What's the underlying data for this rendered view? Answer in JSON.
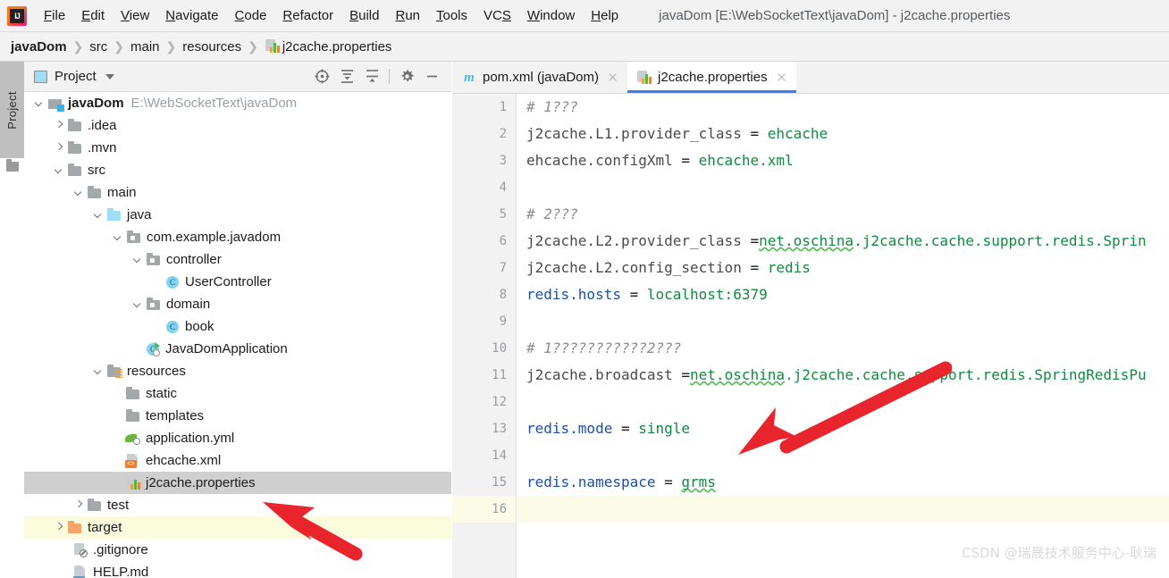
{
  "window": {
    "title": "javaDom [E:\\WebSocketText\\javaDom] - j2cache.properties",
    "app_icon": "intellij-idea-logo"
  },
  "menubar": {
    "items": [
      {
        "label": "File"
      },
      {
        "label": "Edit"
      },
      {
        "label": "View"
      },
      {
        "label": "Navigate"
      },
      {
        "label": "Code"
      },
      {
        "label": "Refactor"
      },
      {
        "label": "Build"
      },
      {
        "label": "Run"
      },
      {
        "label": "Tools"
      },
      {
        "label": "VCS"
      },
      {
        "label": "Window"
      },
      {
        "label": "Help"
      }
    ]
  },
  "breadcrumb": {
    "items": [
      {
        "label": "javaDom",
        "bold": true
      },
      {
        "label": "src"
      },
      {
        "label": "main"
      },
      {
        "label": "resources"
      },
      {
        "label": "j2cache.properties",
        "icon": "properties-file-icon"
      }
    ],
    "separator": "❯"
  },
  "tool_strip": {
    "project_tab_label": "Project",
    "folder_icon": "folder-icon"
  },
  "project_panel": {
    "header": {
      "title": "Project",
      "view_icon": "project-view-icon",
      "dropdown_icon": "chevron-down-icon",
      "tools": [
        {
          "name": "select-opened-file-icon",
          "title": "Select Opened File"
        },
        {
          "name": "expand-all-icon",
          "title": "Expand All"
        },
        {
          "name": "collapse-all-icon",
          "title": "Collapse All"
        },
        {
          "name": "gear-icon",
          "title": "Settings"
        },
        {
          "name": "minimize-icon",
          "title": "Hide"
        }
      ]
    },
    "tree": [
      {
        "label": "javaDom",
        "path": "E:\\WebSocketText\\javaDom",
        "icon": "module-folder-icon",
        "indent": 0,
        "arrow": "down",
        "bold": true
      },
      {
        "label": ".idea",
        "icon": "folder-icon",
        "indent": 1,
        "arrow": "right"
      },
      {
        "label": ".mvn",
        "icon": "folder-icon",
        "indent": 1,
        "arrow": "right"
      },
      {
        "label": "src",
        "icon": "folder-icon",
        "indent": 1,
        "arrow": "down"
      },
      {
        "label": "main",
        "icon": "folder-icon",
        "indent": 2,
        "arrow": "down"
      },
      {
        "label": "java",
        "icon": "source-folder-icon",
        "indent": 3,
        "arrow": "down"
      },
      {
        "label": "com.example.javadom",
        "icon": "package-icon",
        "indent": 4,
        "arrow": "down"
      },
      {
        "label": "controller",
        "icon": "package-icon",
        "indent": 5,
        "arrow": "down"
      },
      {
        "label": "UserController",
        "icon": "java-class-icon",
        "indent": 6,
        "arrow": "none"
      },
      {
        "label": "domain",
        "icon": "package-icon",
        "indent": 5,
        "arrow": "down"
      },
      {
        "label": "book",
        "icon": "java-class-icon",
        "indent": 6,
        "arrow": "none"
      },
      {
        "label": "JavaDomApplication",
        "icon": "spring-boot-class-icon",
        "indent": 5,
        "arrow": "none"
      },
      {
        "label": "resources",
        "icon": "resources-folder-icon",
        "indent": 3,
        "arrow": "down"
      },
      {
        "label": "static",
        "icon": "folder-icon",
        "indent": 4,
        "arrow": "none"
      },
      {
        "label": "templates",
        "icon": "folder-icon",
        "indent": 4,
        "arrow": "none"
      },
      {
        "label": "application.yml",
        "icon": "spring-yaml-icon",
        "indent": 4,
        "arrow": "none"
      },
      {
        "label": "ehcache.xml",
        "icon": "xml-file-icon",
        "indent": 4,
        "arrow": "none"
      },
      {
        "label": "j2cache.properties",
        "icon": "properties-file-icon",
        "indent": 4,
        "arrow": "none",
        "selected": true
      },
      {
        "label": "test",
        "icon": "folder-icon",
        "indent": 2,
        "arrow": "right"
      },
      {
        "label": "target",
        "icon": "excluded-folder-icon",
        "indent": 1,
        "arrow": "right",
        "highlighted": true
      },
      {
        "label": ".gitignore",
        "icon": "gitignore-file-icon",
        "indent": 1,
        "arrow": "none"
      },
      {
        "label": "HELP.md",
        "icon": "markdown-file-icon",
        "indent": 1,
        "arrow": "none"
      }
    ]
  },
  "editor": {
    "tabs": [
      {
        "label": "pom.xml (javaDom)",
        "icon": "maven-file-icon",
        "active": false,
        "close_icon": "close-icon"
      },
      {
        "label": "j2cache.properties",
        "icon": "properties-file-icon",
        "active": true,
        "close_icon": "close-icon"
      }
    ],
    "active_line": 16,
    "lines": [
      {
        "n": 1,
        "tokens": [
          {
            "t": "comment",
            "v": "# 1???"
          }
        ]
      },
      {
        "n": 2,
        "tokens": [
          {
            "t": "key",
            "v": "j2cache.L1.provider_class "
          },
          {
            "t": "eq",
            "v": "= "
          },
          {
            "t": "val",
            "v": "ehcache"
          }
        ]
      },
      {
        "n": 3,
        "tokens": [
          {
            "t": "key",
            "v": "ehcache.configXml "
          },
          {
            "t": "eq",
            "v": "= "
          },
          {
            "t": "val",
            "v": "ehcache.xml"
          }
        ]
      },
      {
        "n": 4,
        "tokens": []
      },
      {
        "n": 5,
        "tokens": [
          {
            "t": "comment",
            "v": "# 2???"
          }
        ]
      },
      {
        "n": 6,
        "tokens": [
          {
            "t": "key",
            "v": "j2cache.L2.provider_class "
          },
          {
            "t": "eq",
            "v": "="
          },
          {
            "t": "val-squig",
            "v": "net.oschina"
          },
          {
            "t": "val",
            "v": ".j2cache.cache.support.redis.Sprin"
          }
        ]
      },
      {
        "n": 7,
        "tokens": [
          {
            "t": "key",
            "v": "j2cache.L2.config_section "
          },
          {
            "t": "eq",
            "v": "= "
          },
          {
            "t": "val",
            "v": "redis"
          }
        ]
      },
      {
        "n": 8,
        "tokens": [
          {
            "t": "key-blue",
            "v": "redis.hosts "
          },
          {
            "t": "eq",
            "v": "= "
          },
          {
            "t": "val",
            "v": "localhost:6379"
          }
        ]
      },
      {
        "n": 9,
        "tokens": []
      },
      {
        "n": 10,
        "tokens": [
          {
            "t": "comment",
            "v": "# 1???????????2???"
          }
        ]
      },
      {
        "n": 11,
        "tokens": [
          {
            "t": "key",
            "v": "j2cache.broadcast "
          },
          {
            "t": "eq",
            "v": "="
          },
          {
            "t": "val-squig",
            "v": "net.oschina"
          },
          {
            "t": "val",
            "v": ".j2cache.cache.support.redis.SpringRedisPu"
          }
        ]
      },
      {
        "n": 12,
        "tokens": []
      },
      {
        "n": 13,
        "tokens": [
          {
            "t": "key-blue",
            "v": "redis.mode "
          },
          {
            "t": "eq",
            "v": "= "
          },
          {
            "t": "val",
            "v": "single"
          }
        ]
      },
      {
        "n": 14,
        "tokens": []
      },
      {
        "n": 15,
        "tokens": [
          {
            "t": "key-blue",
            "v": "redis.namespace "
          },
          {
            "t": "eq",
            "v": "= "
          },
          {
            "t": "val-squig",
            "v": "grms"
          }
        ]
      },
      {
        "n": 16,
        "tokens": []
      }
    ]
  },
  "annotations": {
    "arrow_color": "#e8242c",
    "arrows": [
      {
        "name": "arrow-pointing-to-redis-namespace"
      },
      {
        "name": "arrow-pointing-to-j2cache-properties-file"
      }
    ]
  },
  "watermark": {
    "text": "CSDN @瑞晟技术服务中心-耿瑞"
  },
  "colors": {
    "accent": "#3d7ff5",
    "panel_bg": "#f2f2f2",
    "selection": "#cfcfcf",
    "current_line": "#fbfbe8",
    "highlight_row": "#fbfbdd",
    "value_green": "#108a3f",
    "key_blue": "#1b4fa8",
    "comment_gray": "#8c8c8c",
    "arrow_red": "#e8242c"
  }
}
